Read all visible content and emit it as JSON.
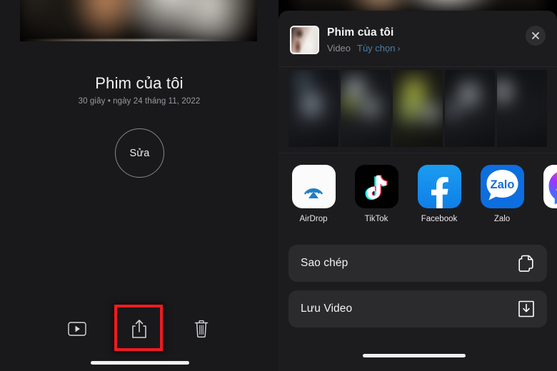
{
  "left_panel": {
    "movie_title": "Phim của tôi",
    "movie_subtitle": "30 giây • ngày 24 tháng 11, 2022",
    "edit_button_label": "Sửa",
    "toolbar": [
      {
        "name": "play-button",
        "icon": "play-icon"
      },
      {
        "name": "share-button",
        "icon": "share-icon"
      },
      {
        "name": "delete-button",
        "icon": "trash-icon"
      }
    ],
    "highlight_color": "#ee1b20"
  },
  "share_sheet": {
    "title": "Phim của tôi",
    "kind": "Video",
    "options_label": "Tùy chọn",
    "options_chevron": "›",
    "options_color": "#4c7fa6",
    "close_icon": "close-icon",
    "apps": [
      {
        "label": "AirDrop",
        "icon": "airdrop-icon"
      },
      {
        "label": "TikTok",
        "icon": "tiktok-icon"
      },
      {
        "label": "Facebook",
        "icon": "facebook-icon"
      },
      {
        "label": "Zalo",
        "icon": "zalo-icon"
      },
      {
        "label": "Me",
        "icon": "messenger-icon"
      }
    ],
    "actions": [
      {
        "label": "Sao chép",
        "icon": "copy-icon"
      },
      {
        "label": "Lưu Video",
        "icon": "save-download-icon"
      }
    ]
  }
}
